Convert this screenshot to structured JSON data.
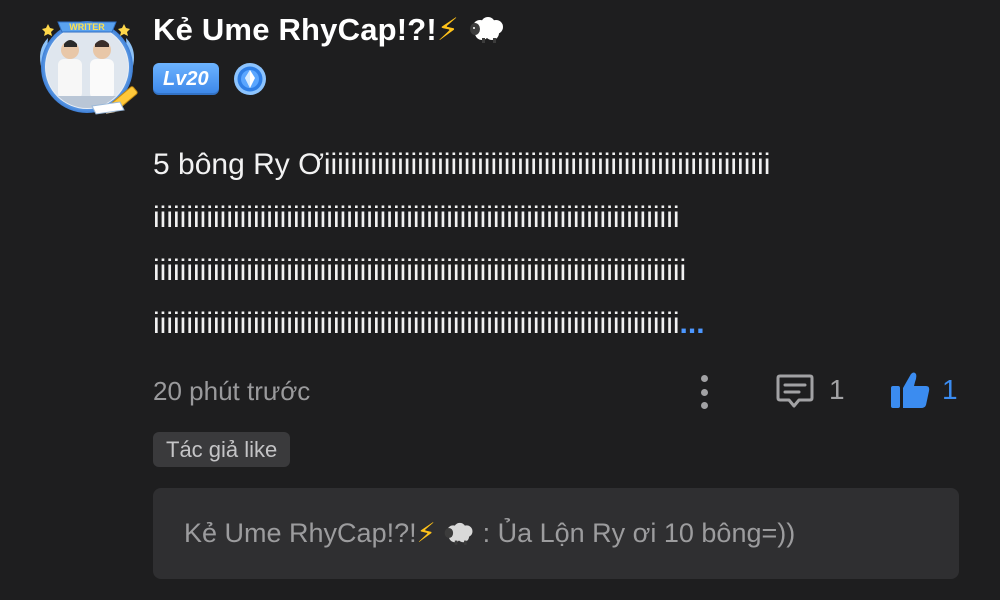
{
  "comment": {
    "author": {
      "name": "Kẻ Ume RhyCap!?!",
      "emoji_1": "⚡",
      "emoji_2": "sheep-icon",
      "level": "Lv20",
      "avatar_frame_label": "WRITER",
      "medal_icon": "blue-medal-icon"
    },
    "body_lines": [
      "5 bông Ry Ơiiiiiiiiiiiiiiiiiiiiiiiiiiiiiiiiiiiiiiiiiiiiiiiiiiiiiiiiiiiiiiiiiii",
      "iiiiiiiiiiiiiiiiiiiiiiiiiiiiiiiiiiiiiiiiiiiiiiiiiiiiiiiiiiiiiiiiiiiiiiiiiiiiiii",
      "iiiiiiiiiiiiiiiiiiiiiiiiiiiiiiiiiiiiiiiiiiiiiiiiiiiiiiiiiiiiiiiiiiiiiiiiiiiiiiii",
      "iiiiiiiiiiiiiiiiiiiiiiiiiiiiiiiiiiiiiiiiiiiiiiiiiiiiiiiiiiiiiiiiiiiiiiiiiiiiiii"
    ],
    "more_text": "...",
    "timestamp": "20 phút trước",
    "reply_count": "1",
    "like_count": "1",
    "author_liked_label": "Tác giả like",
    "accent_color": "#3b8cf0"
  },
  "reply_preview": {
    "author": "Kẻ Ume RhyCap!?!",
    "emoji_1": "⚡",
    "emoji_2": "sheep-icon",
    "separator": " : ",
    "text": "Ủa Lộn Ry ơi 10 bông=))"
  }
}
